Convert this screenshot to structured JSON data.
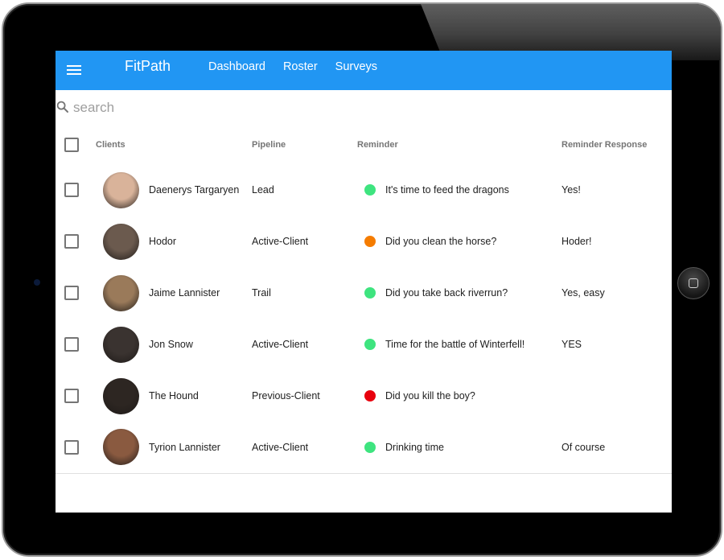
{
  "app": {
    "brand": "FitPath",
    "nav": [
      "Dashboard",
      "Roster",
      "Surveys"
    ]
  },
  "search": {
    "placeholder": "search",
    "value": ""
  },
  "table": {
    "headers": {
      "clients": "Clients",
      "pipeline": "Pipeline",
      "reminder": "Reminder",
      "response": "Reminder Response"
    },
    "rows": [
      {
        "name": "Daenerys Targaryen",
        "pipeline": "Lead",
        "reminder": "It's time to feed the dragons",
        "status": "green",
        "response": "Yes!",
        "avatar_color": "#d9b39a"
      },
      {
        "name": "Hodor",
        "pipeline": "Active-Client",
        "reminder": "Did you clean the horse?",
        "status": "orange",
        "response": "Hoder!",
        "avatar_color": "#6b5a4e"
      },
      {
        "name": "Jaime Lannister",
        "pipeline": "Trail",
        "reminder": "Did you take back riverrun?",
        "status": "green",
        "response": "Yes, easy",
        "avatar_color": "#9a7a5a"
      },
      {
        "name": "Jon Snow",
        "pipeline": "Active-Client",
        "reminder": "Time for the battle of Winterfell!",
        "status": "green",
        "response": "YES",
        "avatar_color": "#3a3330"
      },
      {
        "name": "The Hound",
        "pipeline": "Previous-Client",
        "reminder": "Did you kill the boy?",
        "status": "red",
        "response": "",
        "avatar_color": "#2d2622"
      },
      {
        "name": "Tyrion Lannister",
        "pipeline": "Active-Client",
        "reminder": "Drinking time",
        "status": "green",
        "response": "Of course",
        "avatar_color": "#8a5a40"
      }
    ]
  },
  "colors": {
    "appbar": "#2196f3",
    "status_green": "#3ee47f",
    "status_orange": "#f57c00",
    "status_red": "#e8000d"
  }
}
